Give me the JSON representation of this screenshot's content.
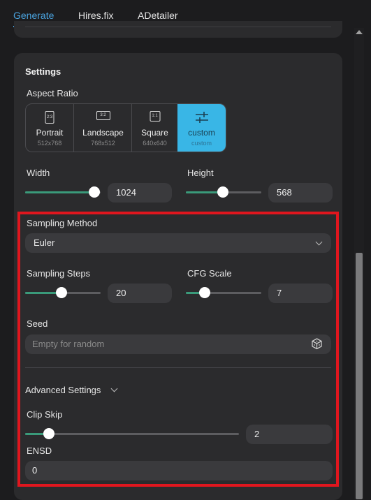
{
  "tabs": [
    {
      "label": "Generate",
      "active": true
    },
    {
      "label": "Hires.fix",
      "active": false
    },
    {
      "label": "ADetailer",
      "active": false
    }
  ],
  "settings": {
    "title": "Settings",
    "aspect_ratio": {
      "label": "Aspect Ratio",
      "options": [
        {
          "name": "Portrait",
          "ratio": "2:3",
          "size": "512x768"
        },
        {
          "name": "Landscape",
          "ratio": "3:2",
          "size": "768x512"
        },
        {
          "name": "Square",
          "ratio": "1:1",
          "size": "640x640"
        },
        {
          "name": "custom",
          "ratio": "custom-sliders-icon",
          "size": "custom",
          "selected": true
        }
      ]
    },
    "width": {
      "label": "Width",
      "value": "1024",
      "slider_fraction": 0.97
    },
    "height": {
      "label": "Height",
      "value": "568",
      "slider_fraction": 0.49
    },
    "sampling_method": {
      "label": "Sampling Method",
      "value": "Euler"
    },
    "sampling_steps": {
      "label": "Sampling Steps",
      "value": "20",
      "slider_fraction": 0.48
    },
    "cfg_scale": {
      "label": "CFG Scale",
      "value": "7",
      "slider_fraction": 0.25
    },
    "seed": {
      "label": "Seed",
      "placeholder": "Empty for random"
    },
    "advanced": {
      "label": "Advanced Settings"
    },
    "clip_skip": {
      "label": "Clip Skip",
      "value": "2",
      "slider_fraction": 0.11
    },
    "ensd": {
      "label": "ENSD",
      "value": "0"
    }
  },
  "colors": {
    "accent": "#4aa3df",
    "selected": "#39b6e6",
    "slider_fill": "#3a9a7a",
    "highlight_box": "#e0161e"
  }
}
